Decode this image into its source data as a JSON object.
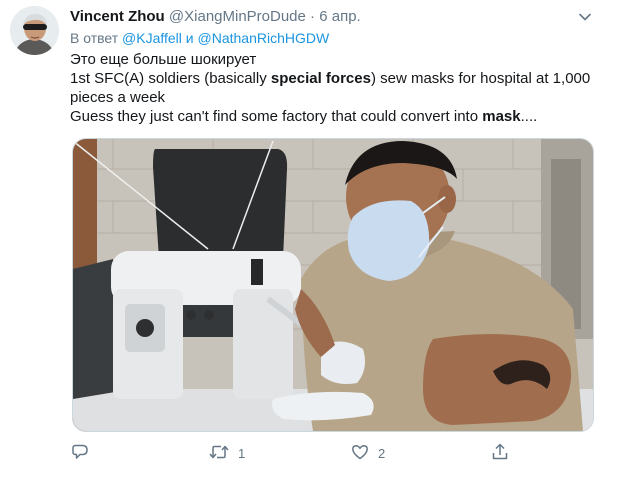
{
  "tweet": {
    "author_name": "Vincent Zhou",
    "author_handle": "@XiangMinProDude",
    "separator": "·",
    "date": "6 апр.",
    "reply_prefix": "В ответ",
    "reply_user1": "@KJaffell",
    "reply_and": "и",
    "reply_user2": "@NathanRichHGDW",
    "line1": "Это еще больше шокирует",
    "line2_a": "1st SFC(A) soldiers (basically ",
    "line2_bold": "special forces",
    "line2_b": ") sew masks for hospital at 1,000 pieces a week",
    "line3_a": "Guess they just can't find some factory that could convert into ",
    "line3_bold": "mask",
    "line3_b": "....",
    "retweet_count": "1",
    "like_count": "2"
  },
  "icons": {
    "menu": "chevron-down-icon",
    "reply": "reply-icon",
    "retweet": "retweet-icon",
    "like": "heart-icon",
    "share": "share-icon"
  },
  "colors": {
    "link": "#1b95e0",
    "secondary_text": "#657786",
    "primary_text": "#14171a"
  }
}
